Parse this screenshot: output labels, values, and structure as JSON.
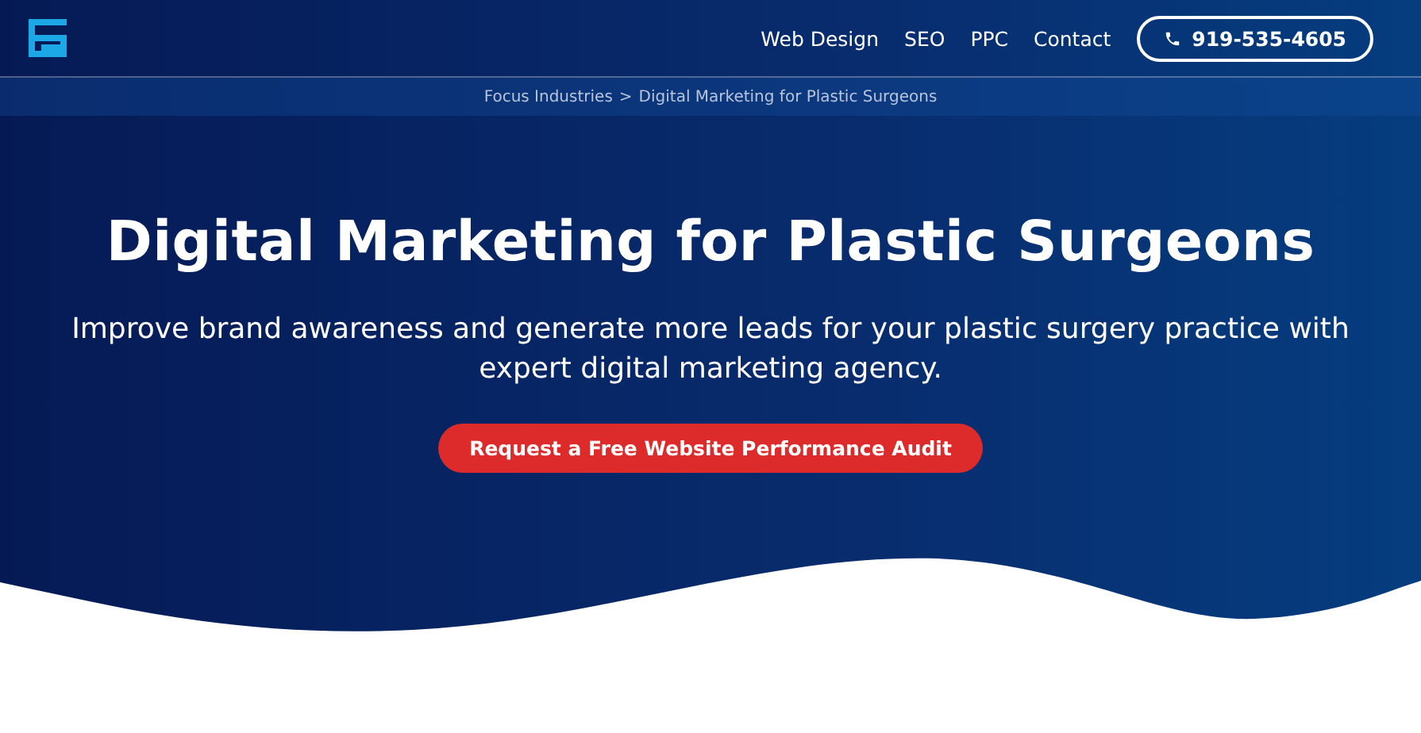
{
  "nav": {
    "links": [
      {
        "label": "Web Design"
      },
      {
        "label": "SEO"
      },
      {
        "label": "PPC"
      },
      {
        "label": "Contact"
      }
    ],
    "phone": "919-535-4605"
  },
  "breadcrumb": {
    "items": [
      {
        "label": "Focus Industries"
      },
      {
        "label": "Digital Marketing for Plastic Surgeons"
      }
    ],
    "separator": ">"
  },
  "hero": {
    "title": "Digital Marketing for Plastic Surgeons",
    "subtitle": "Improve brand awareness and generate more leads for your plastic surgery practice with expert digital marketing agency.",
    "cta": "Request a Free Website Performance Audit"
  }
}
